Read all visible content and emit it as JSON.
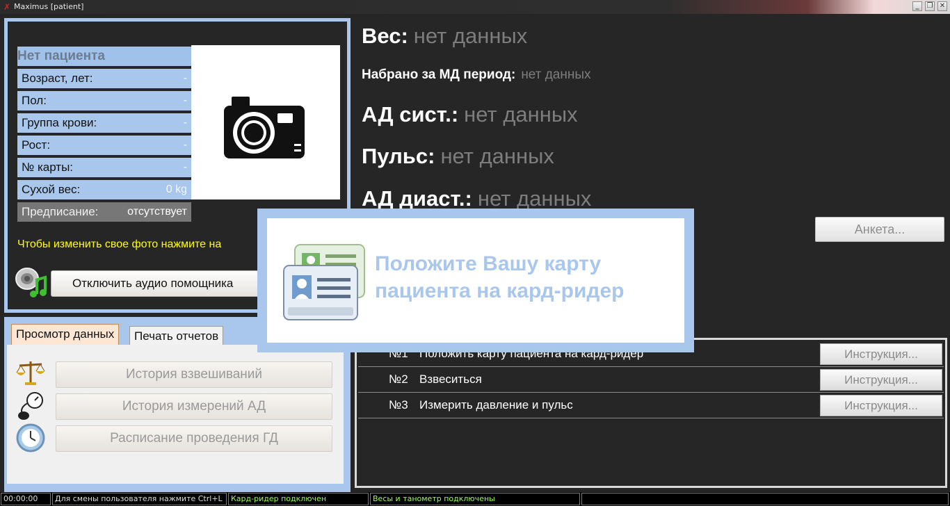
{
  "window": {
    "title": "Maximus [patient]",
    "controls": {
      "minimize": "_",
      "restore": "❐",
      "close": "✕"
    }
  },
  "patient": {
    "name": "Нет пациента",
    "fields": [
      {
        "label": "Возраст, лет:",
        "value": "-"
      },
      {
        "label": "Пол:",
        "value": "-"
      },
      {
        "label": "Группа крови:",
        "value": "-"
      },
      {
        "label": "Рост:",
        "value": "-"
      },
      {
        "label": "№ карты:",
        "value": "-"
      },
      {
        "label": "Сухой вес:",
        "value": "0 kg"
      }
    ],
    "prescription": {
      "label": "Предписание:",
      "value": "отсутствует"
    },
    "photo_hint": "Чтобы изменить свое фото нажмите на",
    "audio_button": "Отключить аудио помощника",
    "photo_icon": "camera-icon",
    "audio_icon": "speaker-music-icon"
  },
  "tabs": {
    "items": [
      {
        "label": "Просмотр данных",
        "active": true
      },
      {
        "label": "Печать отчетов",
        "active": false
      }
    ],
    "history_buttons": [
      {
        "label": "История взвешиваний",
        "icon": "scales-icon"
      },
      {
        "label": "История измерений АД",
        "icon": "tonometer-icon"
      },
      {
        "label": "Расписание проведения ГД",
        "icon": "clock-icon"
      }
    ]
  },
  "vitals": {
    "weight": {
      "label": "Вес:",
      "value": "нет данных"
    },
    "gained": {
      "label": "Набрано за МД период:",
      "value": "нет данных"
    },
    "sys": {
      "label": "АД сист.:",
      "value": "нет данных"
    },
    "pulse": {
      "label": "Пульс:",
      "value": "нет данных"
    },
    "dia": {
      "label": "АД диаст.:",
      "value": "нет данных"
    }
  },
  "anketa_button": "Анкета...",
  "steps": [
    {
      "num": "№1",
      "text": "Положить карту пациента на кард-ридер",
      "button": "Инструкция..."
    },
    {
      "num": "№2",
      "text": "Взвеситься",
      "button": "Инструкция..."
    },
    {
      "num": "№3",
      "text": "Измерить давление и пульс",
      "button": "Инструкция..."
    }
  ],
  "overlay": {
    "line1": "Положите Вашу карту",
    "line2": "пациента на кард-ридер",
    "icon": "id-cards-icon"
  },
  "statusbar": {
    "time": "00:00:00",
    "hint": "Для смены пользователя нажмите Ctrl+L",
    "card_reader": "Кард-ридер подключен",
    "devices": "Весы и танометр подключены"
  },
  "colors": {
    "background": "#262626",
    "panel_blue": "#a9c7ec",
    "hint_yellow": "#ffff00",
    "status_green": "#9cff4a",
    "muted_text": "#7d7d7d"
  }
}
